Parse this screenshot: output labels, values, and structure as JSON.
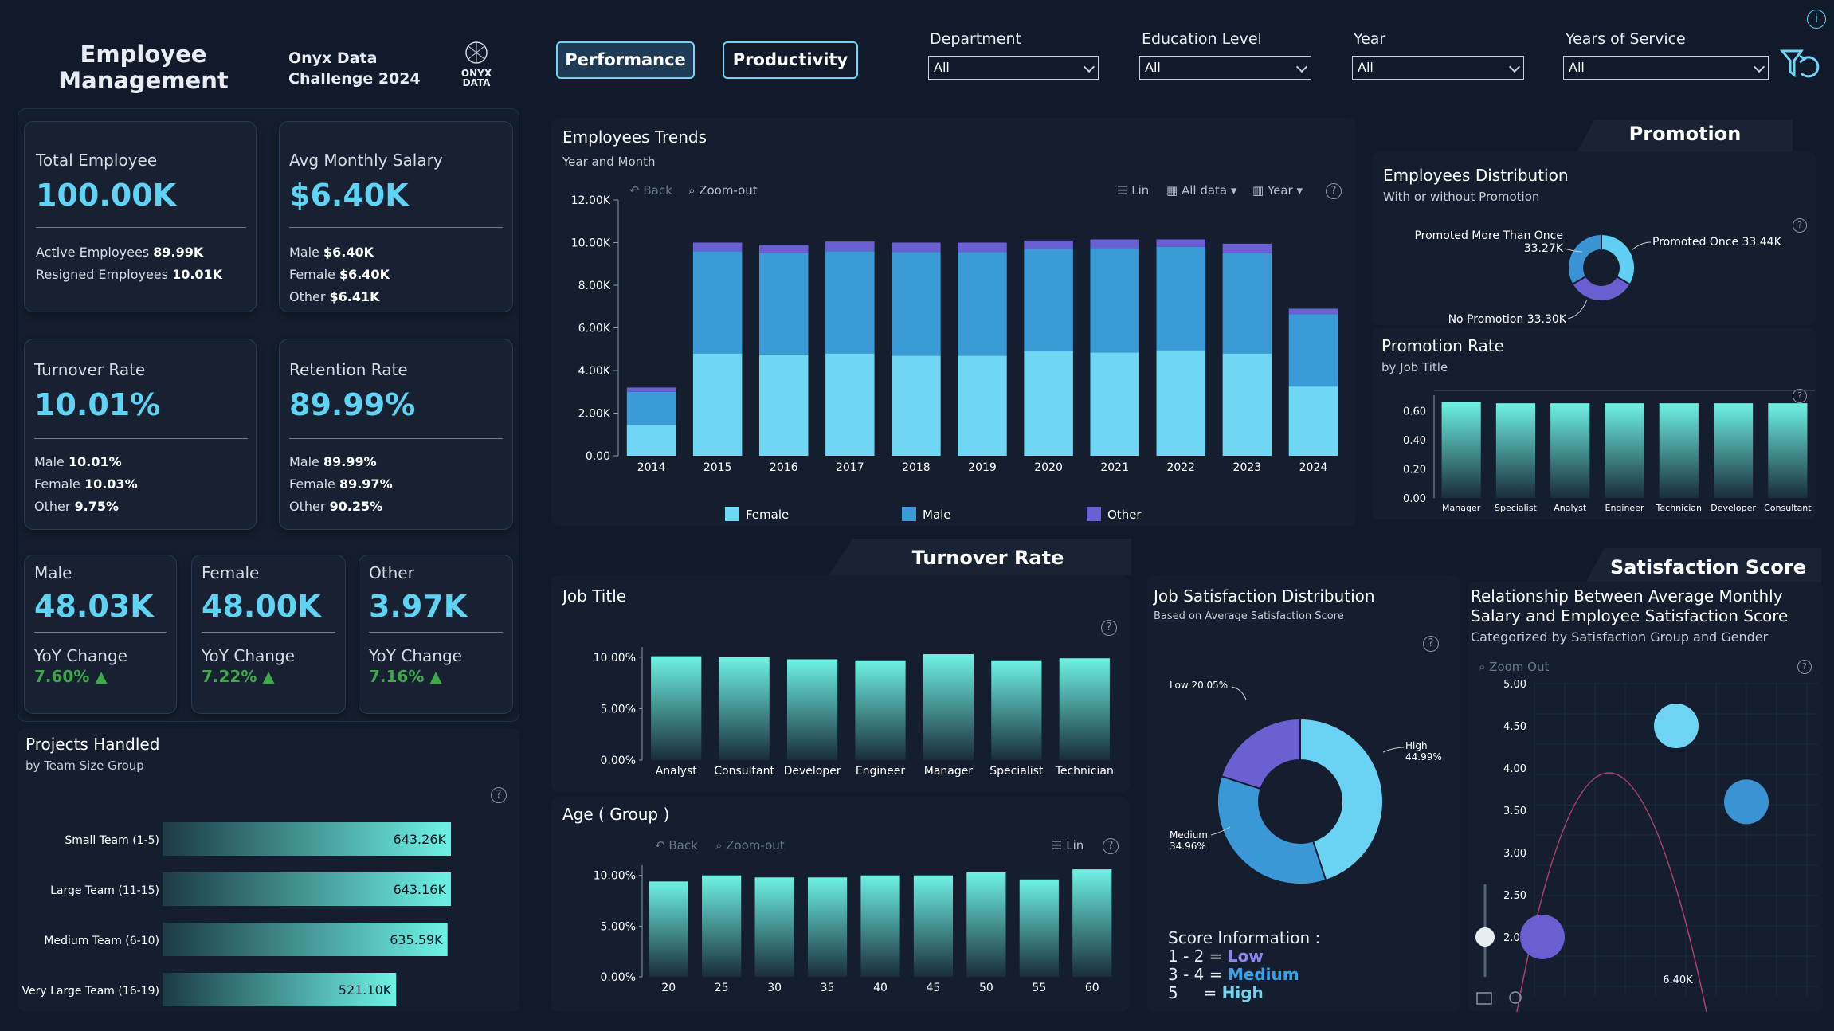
{
  "header": {
    "title_line1": "Employee",
    "title_line2": "Management",
    "challenge_line1": "Onyx Data",
    "challenge_line2": "Challenge 2024",
    "logo_text1": "ONYX",
    "logo_text2": "DATA",
    "btn_performance": "Performance",
    "btn_productivity": "Productivity",
    "filters": [
      {
        "label": "Department",
        "value": "All"
      },
      {
        "label": "Education Level",
        "value": "All"
      },
      {
        "label": "Year",
        "value": "All"
      },
      {
        "label": "Years of Service",
        "value": "All"
      }
    ]
  },
  "kpi": {
    "total": {
      "label": "Total Employee",
      "value": "100.00K",
      "l1": "Active Employees",
      "v1": "89.99K",
      "l2": "Resigned Employees",
      "v2": "10.01K"
    },
    "salary": {
      "label": "Avg Monthly Salary",
      "value": "$6.40K",
      "l1": "Male",
      "v1": "$6.40K",
      "l2": "Female",
      "v2": "$6.40K",
      "l3": "Other",
      "v3": "$6.41K"
    },
    "turnover": {
      "label": "Turnover Rate",
      "value": "10.01%",
      "l1": "Male",
      "v1": "10.01%",
      "l2": "Female",
      "v2": "10.03%",
      "l3": "Other",
      "v3": "9.75%"
    },
    "retention": {
      "label": "Retention Rate",
      "value": "89.99%",
      "l1": "Male",
      "v1": "89.99%",
      "l2": "Female",
      "v2": "89.97%",
      "l3": "Other",
      "v3": "90.25%"
    },
    "male": {
      "label": "Male",
      "value": "48.03K",
      "yoy": "YoY Change",
      "change": "7.60%"
    },
    "female": {
      "label": "Female",
      "value": "48.00K",
      "yoy": "YoY Change",
      "change": "7.22%"
    },
    "other": {
      "label": "Other",
      "value": "3.97K",
      "yoy": "YoY Change",
      "change": "7.16%"
    }
  },
  "projects": {
    "title": "Projects Handled",
    "subtitle": "by Team Size Group",
    "chart_data": {
      "type": "bar",
      "orientation": "horizontal",
      "categories": [
        "Small Team (1-5)",
        "Large Team (11-15)",
        "Medium Team (6-10)",
        "Very Large Team (16-19)"
      ],
      "values": [
        643.26,
        643.16,
        635.59,
        521.1
      ],
      "labels": [
        "643.26K",
        "643.16K",
        "635.59K",
        "521.10K"
      ]
    }
  },
  "trends": {
    "title": "Employees Trends",
    "subtitle": "Year and Month",
    "toolbar": {
      "back": "Back",
      "zoom": "Zoom-out",
      "lin": "Lin",
      "alldata": "All data",
      "year": "Year"
    },
    "chart_data": {
      "type": "bar",
      "stacked": true,
      "categories": [
        "2014",
        "2015",
        "2016",
        "2017",
        "2018",
        "2019",
        "2020",
        "2021",
        "2022",
        "2023",
        "2024"
      ],
      "series": [
        {
          "name": "Female",
          "color": "#6fd6f4",
          "values": [
            1.45,
            4.8,
            4.75,
            4.8,
            4.7,
            4.7,
            4.9,
            4.85,
            4.95,
            4.8,
            3.25
          ]
        },
        {
          "name": "Male",
          "color": "#3a9bd6",
          "values": [
            1.55,
            4.8,
            4.75,
            4.8,
            4.85,
            4.85,
            4.8,
            4.9,
            4.85,
            4.7,
            3.4
          ]
        },
        {
          "name": "Other",
          "color": "#6a60d4",
          "values": [
            0.2,
            0.4,
            0.4,
            0.45,
            0.45,
            0.45,
            0.4,
            0.4,
            0.35,
            0.45,
            0.25
          ]
        }
      ],
      "yticks": [
        "0.00",
        "2.00K",
        "4.00K",
        "6.00K",
        "8.00K",
        "10.00K",
        "12.00K"
      ],
      "ylim": [
        0,
        12
      ]
    }
  },
  "promotion": {
    "tab": "Promotion",
    "title": "Employees Distribution",
    "subtitle": "With or without Promotion",
    "chart_data": {
      "type": "pie",
      "donut": true,
      "labels": [
        "Promoted Once",
        "No Promotion",
        "Promoted More Than Once"
      ],
      "values": [
        33.44,
        33.3,
        33.27
      ],
      "display": [
        "Promoted Once 33.44K",
        "No Promotion 33.30K",
        "Promoted More Than Once",
        "33.27K"
      ],
      "colors": [
        "#5fd0f3",
        "#6a5fd0",
        "#3a93d3"
      ]
    },
    "rate": {
      "title": "Promotion Rate",
      "subtitle": "by Job Title",
      "chart_data": {
        "type": "bar",
        "categories": [
          "Manager",
          "Specialist",
          "Analyst",
          "Engineer",
          "Technician",
          "Developer",
          "Consultant"
        ],
        "values": [
          0.66,
          0.65,
          0.65,
          0.65,
          0.65,
          0.65,
          0.65
        ],
        "yticks": [
          "0.00",
          "0.20",
          "0.40",
          "0.60"
        ],
        "ylim": [
          0,
          0.7
        ]
      }
    }
  },
  "turnover": {
    "tab": "Turnover Rate",
    "job": {
      "title": "Job Title",
      "chart_data": {
        "type": "bar",
        "categories": [
          "Analyst",
          "Consultant",
          "Developer",
          "Engineer",
          "Manager",
          "Specialist",
          "Technician"
        ],
        "values": [
          10.1,
          10.0,
          9.8,
          9.7,
          10.3,
          9.7,
          9.9
        ],
        "yticks": [
          "0.00%",
          "5.00%",
          "10.00%"
        ],
        "ylim": [
          0,
          11
        ]
      }
    },
    "age": {
      "title": "Age ( Group )",
      "toolbar": {
        "back": "Back",
        "zoom": "Zoom-out",
        "lin": "Lin"
      },
      "chart_data": {
        "type": "bar",
        "categories": [
          "20",
          "25",
          "30",
          "35",
          "40",
          "45",
          "50",
          "55",
          "60"
        ],
        "values": [
          9.4,
          10.0,
          9.8,
          9.8,
          10.0,
          10.0,
          10.3,
          9.6,
          10.6
        ],
        "yticks": [
          "0.00%",
          "5.00%",
          "10.00%"
        ],
        "ylim": [
          0,
          11
        ]
      }
    }
  },
  "jobsat": {
    "title": "Job Satisfaction Distribution",
    "subtitle": "Based on Average Satisfaction Score",
    "chart_data": {
      "type": "pie",
      "donut": true,
      "labels": [
        "High",
        "Medium",
        "Low"
      ],
      "values": [
        44.99,
        34.96,
        20.05
      ],
      "display": [
        "High",
        "44.99%",
        "Medium",
        "34.96%",
        "Low 20.05%"
      ],
      "colors": [
        "#6ad3f3",
        "#3a98d6",
        "#6a60d2"
      ]
    },
    "score_title": "Score Information :",
    "scores": [
      {
        "range": "1 - 2 = ",
        "name": "Low"
      },
      {
        "range": "3 - 4 = ",
        "name": "Medium"
      },
      {
        "range": "5     = ",
        "name": "High"
      }
    ]
  },
  "satisfaction": {
    "tab": "Satisfaction Score",
    "title1": "Relationship Between Average Monthly",
    "title2": "Salary and Employee Satisfaction Score",
    "subtitle": "Categorized by Satisfaction Group and Gender",
    "zoom": "Zoom Out",
    "xlabel_val": "6.40K",
    "chart_data": {
      "type": "scatter",
      "yticks": [
        "2.00",
        "2.50",
        "3.00",
        "3.50",
        "4.00",
        "4.50",
        "5.00"
      ],
      "ylim": [
        2,
        5
      ],
      "points": [
        {
          "y": 4.5,
          "color": "#6fd4f4"
        },
        {
          "y": 3.6,
          "color": "#3a93d3"
        },
        {
          "y": 2.0,
          "color": "#6a5fd0"
        }
      ]
    }
  }
}
